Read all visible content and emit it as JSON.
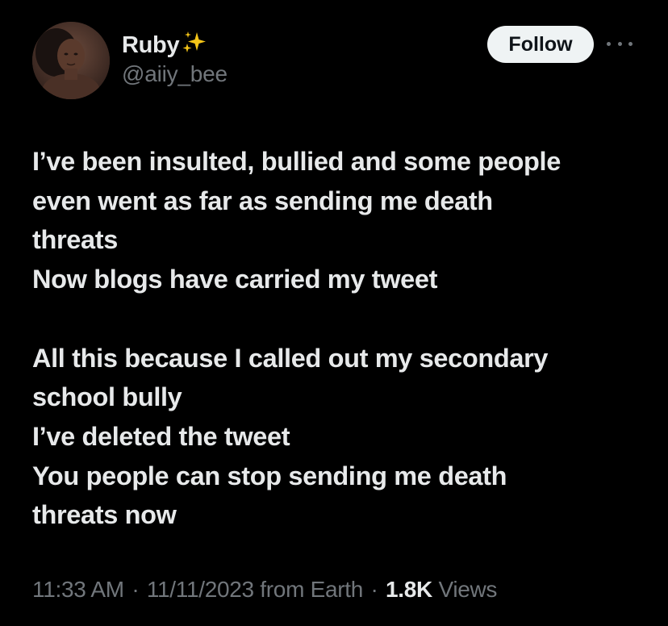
{
  "author": {
    "display_name": "Ruby",
    "handle": "@aiiy_bee",
    "name_emoji_icon": "sparkles-icon",
    "avatar_icon": "avatar"
  },
  "actions": {
    "follow_label": "Follow",
    "more_icon": "more-options-icon"
  },
  "tweet": {
    "lines": [
      "I’ve been insulted, bullied and some people",
      "even went as far as sending me death",
      "threats",
      "Now blogs have carried my tweet",
      "",
      "All this because I called out my secondary",
      "school bully",
      "I’ve deleted the tweet",
      "You people can stop sending me death",
      "threats now"
    ]
  },
  "meta": {
    "time": "11:33 AM",
    "separator": "·",
    "date": "11/11/2023",
    "source": "from Earth",
    "views_count": "1.8K",
    "views_label": "Views"
  },
  "colors": {
    "background": "#000000",
    "primary_text": "#e7e9ea",
    "secondary_text": "#71767b",
    "follow_bg": "#eff3f4",
    "sparkle": "#f5c518"
  }
}
